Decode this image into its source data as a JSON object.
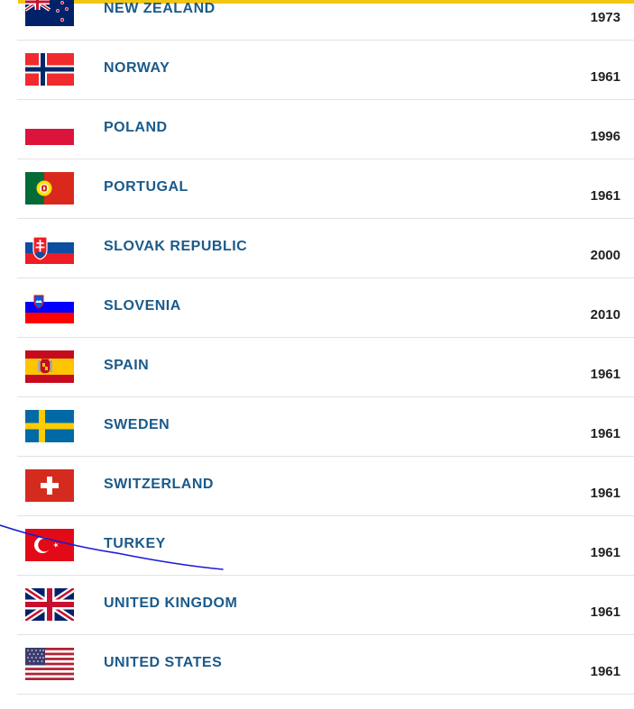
{
  "colors": {
    "accent_bar": "#f3c612",
    "link": "#1a5a8a",
    "divider": "#e2e2e2",
    "annotation": "#1a1ad6"
  },
  "countries": [
    {
      "name": "NEW ZEALAND",
      "year": "1973",
      "flag_icon": "new-zealand-flag-icon"
    },
    {
      "name": "NORWAY",
      "year": "1961",
      "flag_icon": "norway-flag-icon"
    },
    {
      "name": "POLAND",
      "year": "1996",
      "flag_icon": "poland-flag-icon"
    },
    {
      "name": "PORTUGAL",
      "year": "1961",
      "flag_icon": "portugal-flag-icon"
    },
    {
      "name": "SLOVAK REPUBLIC",
      "year": "2000",
      "flag_icon": "slovakia-flag-icon"
    },
    {
      "name": "SLOVENIA",
      "year": "2010",
      "flag_icon": "slovenia-flag-icon"
    },
    {
      "name": "SPAIN",
      "year": "1961",
      "flag_icon": "spain-flag-icon"
    },
    {
      "name": "SWEDEN",
      "year": "1961",
      "flag_icon": "sweden-flag-icon"
    },
    {
      "name": "SWITZERLAND",
      "year": "1961",
      "flag_icon": "switzerland-flag-icon"
    },
    {
      "name": "TURKEY",
      "year": "1961",
      "flag_icon": "turkey-flag-icon"
    },
    {
      "name": "UNITED KINGDOM",
      "year": "1961",
      "flag_icon": "united-kingdom-flag-icon"
    },
    {
      "name": "UNITED STATES",
      "year": "1961",
      "flag_icon": "united-states-flag-icon"
    }
  ]
}
